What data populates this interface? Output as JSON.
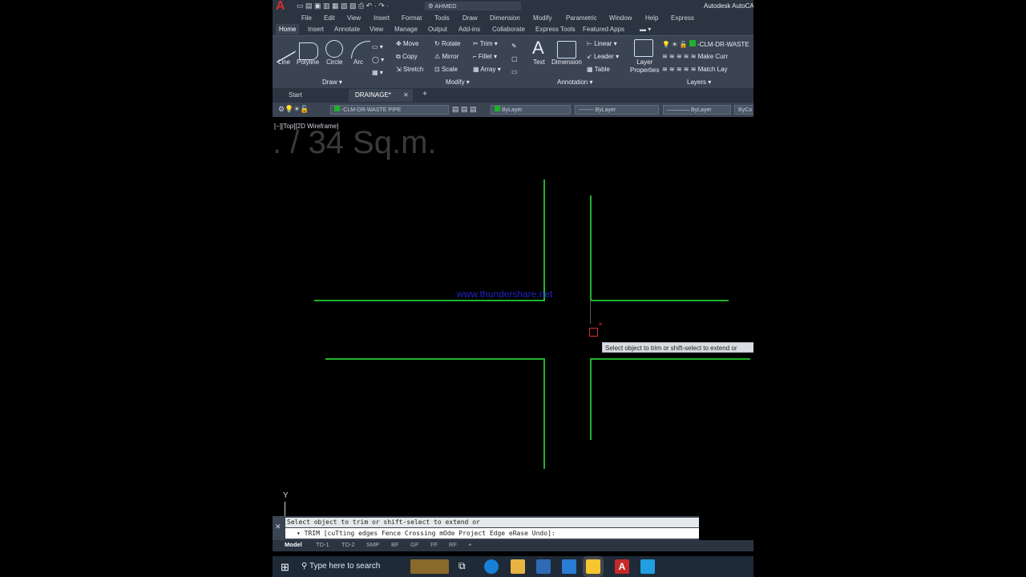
{
  "app": {
    "title": "Autodesk AutoCA",
    "workspace": "AHMED"
  },
  "menu": [
    "File",
    "Edit",
    "View",
    "Insert",
    "Format",
    "Tools",
    "Draw",
    "Dimension",
    "Modify",
    "Parametric",
    "Window",
    "Help",
    "Express"
  ],
  "ribbon_tabs": [
    "Home",
    "Insert",
    "Annotate",
    "View",
    "Manage",
    "Output",
    "Add-ins",
    "Collaborate",
    "Express Tools",
    "Featured Apps"
  ],
  "draw": {
    "tools": [
      "Line",
      "Polyline",
      "Circle",
      "Arc"
    ],
    "panel": "Draw ▾"
  },
  "modify": {
    "tools": [
      "Move",
      "Rotate",
      "Trim",
      "Copy",
      "Mirror",
      "Fillet",
      "Stretch",
      "Scale",
      "Array"
    ],
    "panel": "Modify ▾"
  },
  "annotation": {
    "text": "Text",
    "dimension": "Dimension",
    "linear": "Linear",
    "leader": "Leader",
    "table": "Table",
    "panel": "Annotation ▾"
  },
  "layers": {
    "props": "Layer\nProperties",
    "current": "-CLM-DR-WASTE",
    "make": "Make Curr",
    "match": "Match Lay",
    "panel": "Layers ▾"
  },
  "filetabs": {
    "start": "Start",
    "drawing": "DRAINAGE*",
    "close": "✕",
    "add": "+"
  },
  "props_bar": {
    "layer": "-CLM-DR-WASTE PIPE",
    "color": "ByLayer",
    "linetype": "-------- ByLayer",
    "lineweight": "———— ByLayer",
    "plot": "ByCo"
  },
  "viewport": {
    "label": "[−][Top][2D Wireframe]",
    "area_text": ". / 34 Sq.m.",
    "watermark": "www.thundershare.net"
  },
  "tooltip": "Select object to trim or shift-select to extend or",
  "command": {
    "history": "Select object to trim or shift-select to extend or",
    "prompt": "▾ TRIM [cuTting edges Fence Crossing mOde Project Edge eRase Undo]:",
    "axis": "Y"
  },
  "layout_tabs": [
    "Model",
    "TD-1",
    "TD-2",
    "SMP",
    "BF",
    "GF",
    "FF",
    "RF",
    "+"
  ],
  "taskbar": {
    "search": "Type here to search"
  },
  "colors": {
    "accent": "#1db32a",
    "ribbon": "#3b4453",
    "title": "#2b3441"
  }
}
